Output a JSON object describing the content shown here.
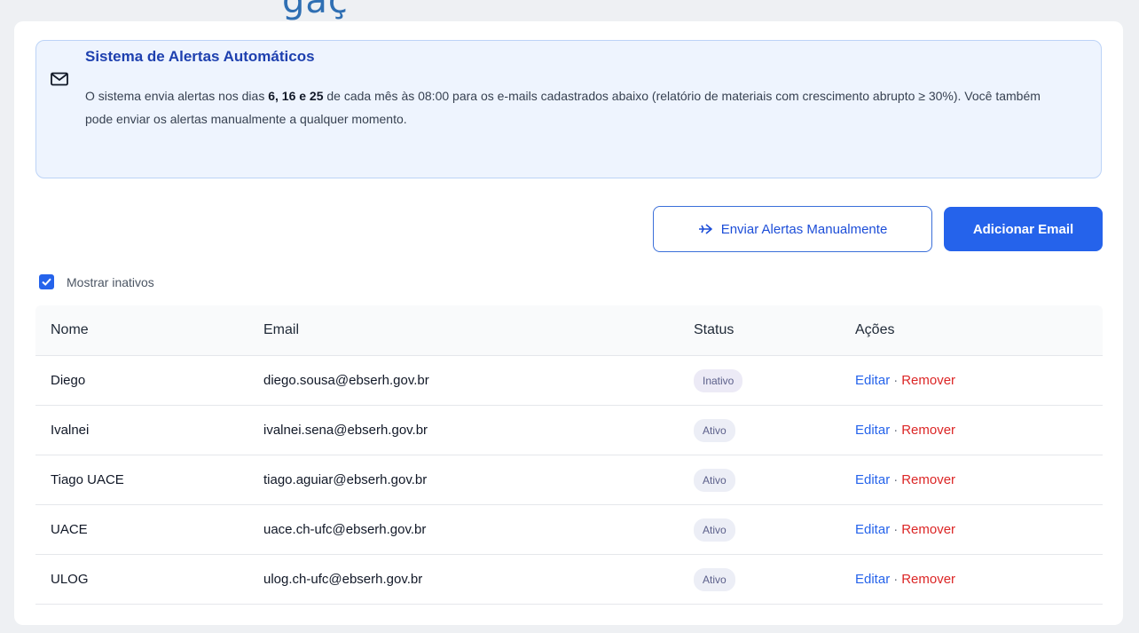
{
  "page": {
    "title_peek": "gaç"
  },
  "alert_box": {
    "icon": "mail-icon",
    "title": "Sistema de Alertas Automáticos",
    "text_before": "O sistema envia alertas nos dias ",
    "days": "6, 16 e 25",
    "text_after": " de cada mês às 08:00 para os e-mails cadastrados abaixo (relatório de materiais com crescimento abrupto ≥ 30%). Você também pode enviar os alertas manualmente a qualquer momento."
  },
  "toolbar": {
    "send_manual_label": "Enviar Alertas Manualmente",
    "send_manual_icon": "send-icon",
    "add_email_label": "Adicionar Email"
  },
  "filter": {
    "show_inactive_label": "Mostrar inativos",
    "show_inactive_checked": true
  },
  "table": {
    "headers": {
      "nome": "Nome",
      "email": "Email",
      "status": "Status",
      "acoes": "Ações"
    },
    "rows": [
      {
        "nome": "Diego",
        "email": "diego.sousa@ebserh.gov.br",
        "status": "Inativo",
        "edit": "Editar",
        "sep": "·",
        "remove": "Remover"
      },
      {
        "nome": "Ivalnei",
        "email": "ivalnei.sena@ebserh.gov.br",
        "status": "Ativo",
        "edit": "Editar",
        "sep": "·",
        "remove": "Remover"
      },
      {
        "nome": "Tiago UACE",
        "email": "tiago.aguiar@ebserh.gov.br",
        "status": "Ativo",
        "edit": "Editar",
        "sep": "·",
        "remove": "Remover"
      },
      {
        "nome": "UACE",
        "email": "uace.ch-ufc@ebserh.gov.br",
        "status": "Ativo",
        "edit": "Editar",
        "sep": "·",
        "remove": "Remover"
      },
      {
        "nome": "ULOG",
        "email": "ulog.ch-ufc@ebserh.gov.br",
        "status": "Ativo",
        "edit": "Editar",
        "sep": "·",
        "remove": "Remover"
      }
    ]
  },
  "colors": {
    "primary": "#2563eb",
    "danger": "#dc2626",
    "info_bg": "#eef4fe",
    "info_border": "#bcd3f7",
    "title_blue": "#1e40af"
  }
}
